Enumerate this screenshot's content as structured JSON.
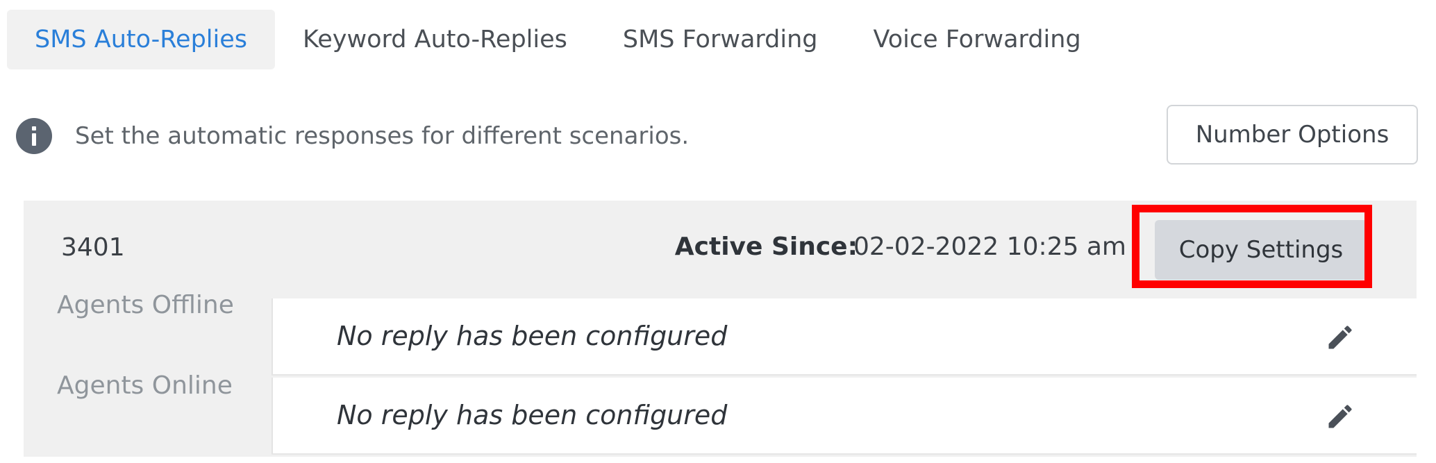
{
  "tabs": [
    {
      "label": "SMS Auto-Replies",
      "active": true
    },
    {
      "label": "Keyword Auto-Replies",
      "active": false
    },
    {
      "label": "SMS Forwarding",
      "active": false
    },
    {
      "label": "Voice Forwarding",
      "active": false
    }
  ],
  "info": {
    "icon": "info-icon",
    "text": "Set the automatic responses for different scenarios."
  },
  "number_options_label": "Number Options",
  "panel": {
    "number": "3401",
    "active_since_label": "Active Since:",
    "active_since_value": "02-02-2022 10:25 am",
    "copy_settings_label": "Copy Settings",
    "highlight_color": "#ff0000",
    "rows": [
      {
        "label": "Agents Offline",
        "reply": "No reply has been configured",
        "icon": "pencil-icon"
      },
      {
        "label": "Agents Online",
        "reply": "No reply has been configured",
        "icon": "pencil-icon"
      }
    ]
  },
  "colors": {
    "accent": "#2a7fd9",
    "panel_bg": "#f0f0f0",
    "button_bg": "#d5d8dd"
  }
}
